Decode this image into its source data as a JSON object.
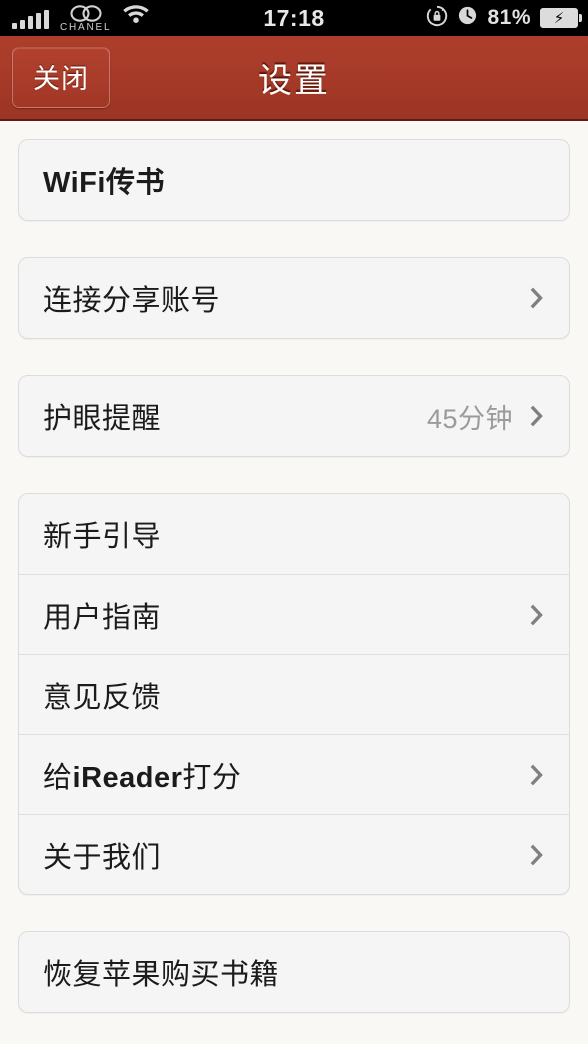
{
  "status_bar": {
    "carrier": "CHANEL",
    "carrier_logo": "chanel-double-c-logo",
    "signal_icon": "signal-bars-icon",
    "signal_bars": 5,
    "wifi_icon": "wifi-icon",
    "time": "17:18",
    "rotation_lock_icon": "rotation-lock-icon",
    "alarm_icon": "alarm-clock-icon",
    "battery_percent": "81%",
    "battery_icon": "battery-charging-icon"
  },
  "nav_bar": {
    "close_label": "关闭",
    "title": "设置",
    "background_color": "#A63A28",
    "title_color": "#FFFFFF"
  },
  "groups": [
    {
      "id": "group-transfer",
      "rows": [
        {
          "label": "WiFi传书",
          "bold": true,
          "value": "",
          "chevron": false,
          "name": "row-wifi-transfer"
        }
      ]
    },
    {
      "id": "group-account",
      "rows": [
        {
          "label": "连接分享账号",
          "bold": false,
          "value": "",
          "chevron": true,
          "name": "row-connect-share-account"
        }
      ]
    },
    {
      "id": "group-eyecare",
      "rows": [
        {
          "label": "护眼提醒",
          "bold": false,
          "value": "45分钟",
          "chevron": true,
          "name": "row-eye-care-reminder"
        }
      ]
    },
    {
      "id": "group-help",
      "rows": [
        {
          "label": "新手引导",
          "bold": false,
          "value": "",
          "chevron": false,
          "name": "row-beginner-guide"
        },
        {
          "label": "用户指南",
          "bold": false,
          "value": "",
          "chevron": true,
          "name": "row-user-manual"
        },
        {
          "label": "意见反馈",
          "bold": false,
          "value": "",
          "chevron": false,
          "name": "row-feedback"
        },
        {
          "label": "给iReader打分",
          "bold": false,
          "value": "",
          "chevron": true,
          "name": "row-rate-ireader",
          "rich": "给<b>iReader</b>打分"
        },
        {
          "label": "关于我们",
          "bold": false,
          "value": "",
          "chevron": true,
          "name": "row-about-us"
        }
      ]
    },
    {
      "id": "group-restore",
      "rows": [
        {
          "label": "恢复苹果购买书籍",
          "bold": false,
          "value": "",
          "chevron": false,
          "name": "row-restore-apple-purchases"
        }
      ]
    }
  ],
  "colors": {
    "page_background": "#FAF8F4",
    "card_background": "#F5F5F5",
    "card_border": "#DCDCDC",
    "label_text": "#1B1B1B",
    "value_text": "#9B9B9B",
    "chevron": "#808080"
  }
}
